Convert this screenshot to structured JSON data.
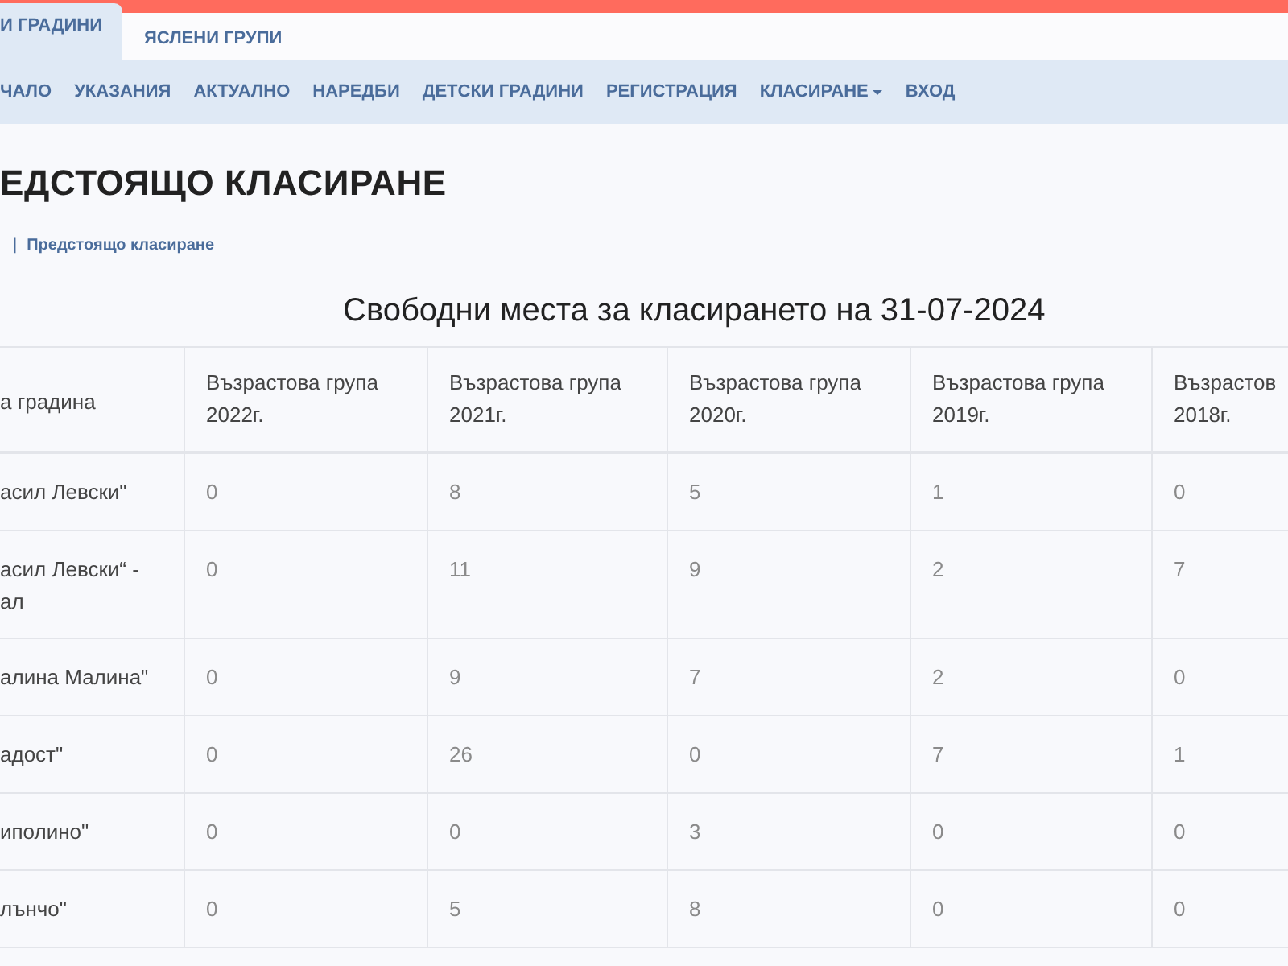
{
  "tabs": [
    {
      "label": "И ГРАДИНИ",
      "selected": true
    },
    {
      "label": "ЯСЛЕНИ ГРУПИ",
      "selected": false
    }
  ],
  "nav": [
    {
      "label": "ЧАЛО",
      "dropdown": false
    },
    {
      "label": "УКАЗАНИЯ",
      "dropdown": false
    },
    {
      "label": "АКТУАЛНО",
      "dropdown": false
    },
    {
      "label": "НАРЕДБИ",
      "dropdown": false
    },
    {
      "label": "ДЕТСКИ ГРАДИНИ",
      "dropdown": false
    },
    {
      "label": "РЕГИСТРАЦИЯ",
      "dropdown": false
    },
    {
      "label": "КЛАСИРАНЕ",
      "dropdown": true
    },
    {
      "label": "ВХОД",
      "dropdown": false
    }
  ],
  "page_title": "ЕДСТОЯЩО КЛАСИРАНЕ",
  "breadcrumb": {
    "separator": "|",
    "current": "Предстоящо класиране"
  },
  "table": {
    "caption": "Свободни места за класирането на 31-07-2024",
    "columns": [
      "а градина",
      "Възрастова група 2022г.",
      "Възрастова група 2021г.",
      "Възрастова група 2020г.",
      "Възрастова група 2019г.",
      "Възрастов 2018г."
    ],
    "rows": [
      [
        "асил Левски\"",
        "0",
        "8",
        "5",
        "1",
        "0"
      ],
      [
        "асил Левски“ -\nал",
        "0",
        "11",
        "9",
        "2",
        "7"
      ],
      [
        "алина Малина\"",
        "0",
        "9",
        "7",
        "2",
        "0"
      ],
      [
        "адост\"",
        "0",
        "26",
        "0",
        "7",
        "1"
      ],
      [
        "иполино\"",
        "0",
        "0",
        "3",
        "0",
        "0"
      ],
      [
        "лънчо\"",
        "0",
        "5",
        "8",
        "0",
        "0"
      ]
    ]
  }
}
